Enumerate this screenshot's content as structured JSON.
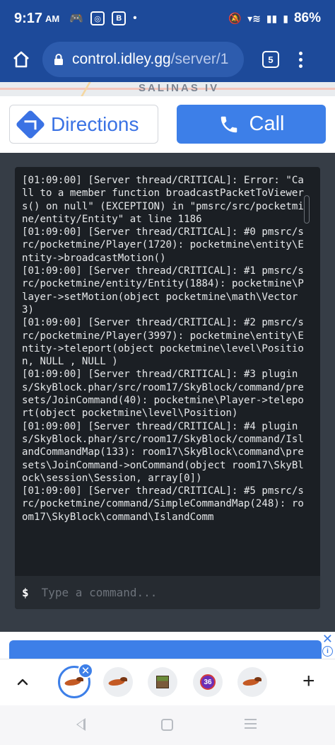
{
  "status_bar": {
    "time": "9:17",
    "ampm": "AM",
    "battery": "86%"
  },
  "browser": {
    "url_host": "control.idley.gg",
    "url_path": "/server/1",
    "tab_count": "5"
  },
  "map": {
    "label": "SALINAS IV"
  },
  "actions": {
    "directions_label": "Directions",
    "call_label": "Call"
  },
  "console": {
    "lines": [
      "[01:09:00] [Server thread/CRITICAL]: Error: \"Call to a member function broadcastPacketToViewers() on null\" (EXCEPTION) in \"pmsrc/src/pocketmine/entity/Entity\" at line 1186",
      "[01:09:00] [Server thread/CRITICAL]: #0 pmsrc/src/pocketmine/Player(1720): pocketmine\\entity\\Entity->broadcastMotion()",
      "[01:09:00] [Server thread/CRITICAL]: #1 pmsrc/src/pocketmine/entity/Entity(1884): pocketmine\\Player->setMotion(object pocketmine\\math\\Vector3)",
      "[01:09:00] [Server thread/CRITICAL]: #2 pmsrc/src/pocketmine/Player(3997): pocketmine\\entity\\Entity->teleport(object pocketmine\\level\\Position, NULL , NULL )",
      "[01:09:00] [Server thread/CRITICAL]: #3 plugins/SkyBlock.phar/src/room17/SkyBlock/command/presets/JoinCommand(40): pocketmine\\Player->teleport(object pocketmine\\level\\Position)",
      "[01:09:00] [Server thread/CRITICAL]: #4 plugins/SkyBlock.phar/src/room17/SkyBlock/command/IslandCommandMap(133): room17\\SkyBlock\\command\\presets\\JoinCommand->onCommand(object room17\\SkyBlock\\session\\Session, array[0])",
      "[01:09:00] [Server thread/CRITICAL]: #5 pmsrc/src/pocketmine/command/SimpleCommandMap(248): room17\\SkyBlock\\command\\IslandComm"
    ],
    "prompt": "$",
    "input_placeholder": "Type a command..."
  },
  "tabs": {
    "badge_count": "36"
  }
}
